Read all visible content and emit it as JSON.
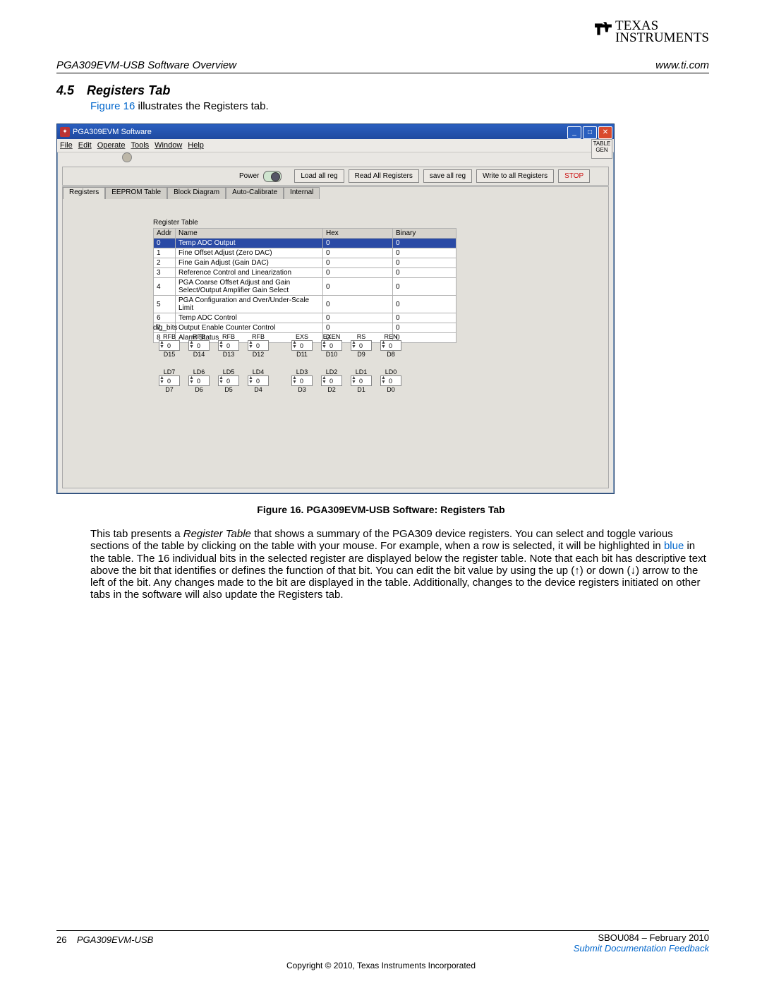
{
  "header": {
    "left": "PGA309EVM-USB Software Overview",
    "right": "www.ti.com",
    "logo_top": "TEXAS",
    "logo_bot": "INSTRUMENTS"
  },
  "section": {
    "num": "4.5",
    "title": "Registers Tab",
    "intro_pre": "Figure 16",
    "intro_post": " illustrates the Registers tab."
  },
  "app": {
    "title": "PGA309EVM Software",
    "menu": [
      "File",
      "Edit",
      "Operate",
      "Tools",
      "Window",
      "Help"
    ],
    "sidebtn_top": "TABLE",
    "sidebtn_bot": "GEN",
    "toolbar": {
      "power": "Power",
      "load": "Load all reg",
      "read": "Read All Registers",
      "save": "save all reg",
      "write": "Write to all Registers",
      "stop": "STOP"
    },
    "tabs": [
      "Registers",
      "EEPROM Table",
      "Block Diagram",
      "Auto-Calibrate",
      "Internal"
    ],
    "active_tab": 0,
    "reg_table_label": "Register Table",
    "reg_headers": [
      "Addr",
      "Name",
      "Hex",
      "Binary"
    ],
    "reg_rows": [
      {
        "addr": "0",
        "name": "Temp ADC Output",
        "hex": "0",
        "bin": "0",
        "sel": true
      },
      {
        "addr": "1",
        "name": "Fine Offset Adjust (Zero DAC)",
        "hex": "0",
        "bin": "0"
      },
      {
        "addr": "2",
        "name": "Fine Gain Adjust (Gain DAC)",
        "hex": "0",
        "bin": "0"
      },
      {
        "addr": "3",
        "name": "Reference Control and Linearization",
        "hex": "0",
        "bin": "0"
      },
      {
        "addr": "4",
        "name": "PGA Coarse Offset Adjust and Gain Select/Output Amplifier Gain Select",
        "hex": "0",
        "bin": "0"
      },
      {
        "addr": "5",
        "name": "PGA Configuration and Over/Under-Scale Limit",
        "hex": "0",
        "bin": "0"
      },
      {
        "addr": "6",
        "name": "Temp ADC Control",
        "hex": "0",
        "bin": "0"
      },
      {
        "addr": "7",
        "name": "Output Enable Counter Control",
        "hex": "0",
        "bin": "0"
      },
      {
        "addr": "8",
        "name": "Alarm Status",
        "hex": "0",
        "bin": "0"
      }
    ],
    "dig_label": "dig_bits",
    "bits_high": [
      {
        "top": "RFB",
        "val": "0",
        "bot": "D15"
      },
      {
        "top": "RFB",
        "val": "0",
        "bot": "D14"
      },
      {
        "top": "RFB",
        "val": "0",
        "bot": "D13"
      },
      {
        "top": "RFB",
        "val": "0",
        "bot": "D12"
      }
    ],
    "bits_high2": [
      {
        "top": "EXS",
        "val": "0",
        "bot": "D11"
      },
      {
        "top": "EXEN",
        "val": "0",
        "bot": "D10"
      },
      {
        "top": "RS",
        "val": "0",
        "bot": "D9"
      },
      {
        "top": "REN",
        "val": "0",
        "bot": "D8"
      }
    ],
    "bits_low": [
      {
        "top": "LD7",
        "val": "0",
        "bot": "D7"
      },
      {
        "top": "LD6",
        "val": "0",
        "bot": "D6"
      },
      {
        "top": "LD5",
        "val": "0",
        "bot": "D5"
      },
      {
        "top": "LD4",
        "val": "0",
        "bot": "D4"
      }
    ],
    "bits_low2": [
      {
        "top": "LD3",
        "val": "0",
        "bot": "D3"
      },
      {
        "top": "LD2",
        "val": "0",
        "bot": "D2"
      },
      {
        "top": "LD1",
        "val": "0",
        "bot": "D1"
      },
      {
        "top": "LD0",
        "val": "0",
        "bot": "D0"
      }
    ]
  },
  "fig_caption": "Figure 16. PGA309EVM-USB Software: Registers Tab",
  "body": {
    "p1a": "This tab presents a ",
    "p1_em": "Register Table",
    "p1b": " that shows a summary of the PGA309 device registers. You can select and toggle various sections of the table by clicking on the table with your mouse. For example, when a row is selected, it will be highlighted in ",
    "p1_blue": "blue",
    "p1c": " in the table. The 16 individual bits in the selected register are displayed below the register table. Note that each bit has descriptive text above the bit that identifies or defines the function of that bit. You can edit the bit value by using the up (↑) or down (↓) arrow to the left of the bit. Any changes made to the bit are displayed in the table. Additionally, changes to the device registers initiated on other tabs in the software will also update the Registers tab."
  },
  "footer": {
    "page": "26",
    "doc": "PGA309EVM-USB",
    "right_top": "SBOU084 – February 2010",
    "right_link": "Submit Documentation Feedback",
    "copyright": "Copyright © 2010, Texas Instruments Incorporated"
  }
}
